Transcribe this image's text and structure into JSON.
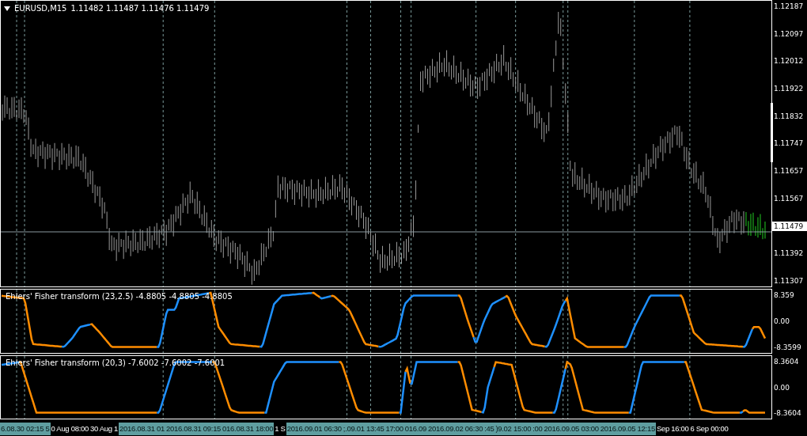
{
  "chart": {
    "symbol": "EURUSD,M15",
    "ohlc": "1.11482 1.11487 1.11476 1.11479",
    "price_axis": [
      {
        "label": "1.12187",
        "highlighted": false
      },
      {
        "label": "1.12097",
        "highlighted": false
      },
      {
        "label": "1.12012",
        "highlighted": false
      },
      {
        "label": "1.11922",
        "highlighted": false
      },
      {
        "label": "1.11832",
        "highlighted": false
      },
      {
        "label": "1.11747",
        "highlighted": false
      },
      {
        "label": "1.11657",
        "highlighted": false
      },
      {
        "label": "1.11567",
        "highlighted": false
      },
      {
        "label": "1.11479",
        "highlighted": true
      },
      {
        "label": "1.11392",
        "highlighted": false
      },
      {
        "label": "1.11307",
        "highlighted": false
      }
    ]
  },
  "indicators": [
    {
      "label": "Ehlers' Fisher transform (23,2.5) -4.8805 -4.8805 -4.8805",
      "axis": [
        "8.359",
        "0.00",
        "-8.3599"
      ]
    },
    {
      "label": "Ehlers' Fisher transform (20,3) -7.6002 -7.6002 -7.6001",
      "axis": [
        "8.3604",
        "0.00",
        "-8.3604"
      ]
    }
  ],
  "time_axis": [
    {
      "label": "6.08.30 02:15 5",
      "highlighted": true
    },
    {
      "label": "0 Aug 08:00",
      "highlighted": false
    },
    {
      "label": "30 Aug 1",
      "highlighted": false
    },
    {
      "label": "2016.08.31 01",
      "highlighted": true
    },
    {
      "label": "2016.08.31 09:15",
      "highlighted": true
    },
    {
      "label": "016.08.31 18:00",
      "highlighted": true
    },
    {
      "label": "1 S",
      "highlighted": false
    },
    {
      "label": "2016.09.01 06:30",
      "highlighted": true
    },
    {
      "label": ";.09.01 13:45",
      "highlighted": true
    },
    {
      "label": "17:00",
      "highlighted": true
    },
    {
      "label": "016.09",
      "highlighted": true
    },
    {
      "label": "2016.09.02 06:30",
      "highlighted": true
    },
    {
      "label": ":45",
      "highlighted": true
    },
    {
      "label": ")9.02 15:00",
      "highlighted": true
    },
    {
      "label": ":00",
      "highlighted": true
    },
    {
      "label": "2016.09.05 03:00",
      "highlighted": true
    },
    {
      "label": "2016.09.05 12:15",
      "highlighted": true
    },
    {
      "label": "Sep 16:00",
      "highlighted": false
    },
    {
      "label": "6 Sep 00:00",
      "highlighted": false
    }
  ]
}
